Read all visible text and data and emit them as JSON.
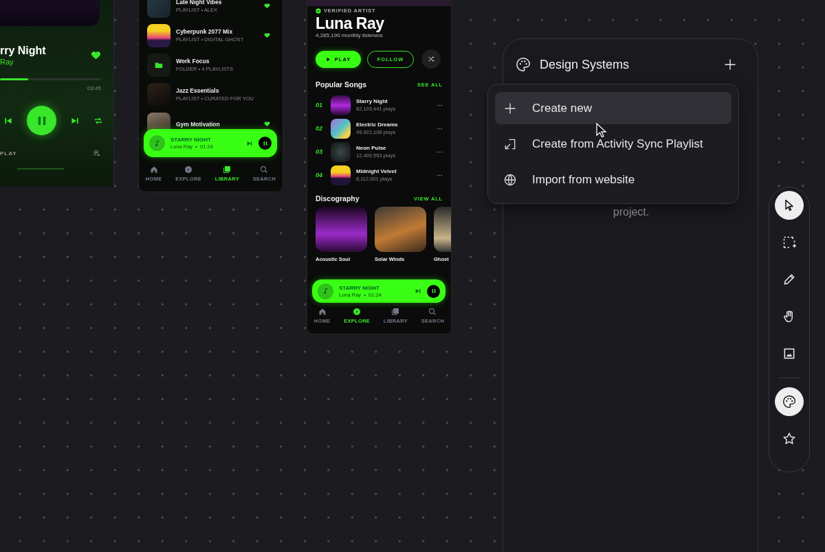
{
  "player": {
    "title": "rry Night",
    "artist": "Ray",
    "liked": true,
    "progress": {
      "level": 0.28
    },
    "time": "03:45",
    "playing": true,
    "queue_label": "PLAY"
  },
  "library": {
    "items": [
      {
        "title": "Late Night Vibes",
        "subtitle": "PLAYLIST • ALEX",
        "kind": "playlist",
        "liked": true
      },
      {
        "title": "Cyberpunk 2077 Mix",
        "subtitle": "PLAYLIST • DIGITAL GHOST",
        "kind": "playlist",
        "liked": true
      },
      {
        "title": "Work Focus",
        "subtitle": "FOLDER • 4 PLAYLISTS",
        "kind": "folder",
        "liked": false
      },
      {
        "title": "Jazz Essentials",
        "subtitle": "PLAYLIST • CURATED FOR YOU",
        "kind": "playlist",
        "liked": false
      },
      {
        "title": "Gym Motivation",
        "kind": "playlist",
        "liked": true
      }
    ],
    "mini_player": {
      "title": "STARRY NIGHT",
      "meta": "Luna Ray  •  01:24",
      "playing": true
    },
    "nav": [
      {
        "kind": "home",
        "label": "HOME",
        "selected": false
      },
      {
        "kind": "explore",
        "label": "EXPLORE",
        "selected": false
      },
      {
        "kind": "library",
        "label": "LIBRARY",
        "selected": true
      },
      {
        "kind": "search",
        "label": "SEARCH",
        "selected": false
      }
    ]
  },
  "artist": {
    "badge": "VERIFIED ARTIST",
    "name": "Luna Ray",
    "listeners": "4,285,190 monthly listeners",
    "play": "PLAY",
    "follow": "FOLLOW",
    "songs_heading": "Popular Songs",
    "see_all": "SEE ALL",
    "songs": [
      {
        "rank": "01",
        "title": "Starry Night",
        "plays": "82,103,441 plays"
      },
      {
        "rank": "02",
        "title": "Electric Dreams",
        "plays": "45,922,108 plays"
      },
      {
        "rank": "03",
        "title": "Neon Pulse",
        "plays": "12,409,553 plays"
      },
      {
        "rank": "04",
        "title": "Midnight Velvet",
        "plays": "8,112,001 plays"
      }
    ],
    "disco_heading": "Discography",
    "view_all": "VIEW ALL",
    "albums": [
      {
        "title": "Acoustic Soul"
      },
      {
        "title": "Solar Winds"
      },
      {
        "title": "Ghost"
      }
    ],
    "mini_player": {
      "title": "STARRY NIGHT",
      "meta": "Luna Ray  •  01:24",
      "playing": true
    },
    "nav": [
      {
        "kind": "home",
        "label": "HOME",
        "selected": false
      },
      {
        "kind": "explore",
        "label": "EXPLORE",
        "selected": true
      },
      {
        "kind": "library",
        "label": "LIBRARY",
        "selected": false
      },
      {
        "kind": "search",
        "label": "SEARCH",
        "selected": false
      }
    ]
  },
  "design_panel": {
    "title": "Design Systems",
    "note": "project.",
    "menu": [
      {
        "kind": "plus",
        "label": "Create new",
        "selected": true
      },
      {
        "kind": "import",
        "label": "Create from Activity Sync Playlist",
        "selected": false
      },
      {
        "kind": "globe",
        "label": "Import from website",
        "selected": false
      }
    ]
  },
  "toolbar": {
    "tools": [
      {
        "kind": "select",
        "selected": true
      },
      {
        "kind": "marquee",
        "selected": false
      },
      {
        "kind": "pencil",
        "selected": false
      },
      {
        "kind": "hand",
        "selected": false
      },
      {
        "kind": "image",
        "selected": false
      }
    ],
    "extras": [
      {
        "kind": "palette",
        "selected": true
      },
      {
        "kind": "star",
        "selected": false
      }
    ]
  }
}
